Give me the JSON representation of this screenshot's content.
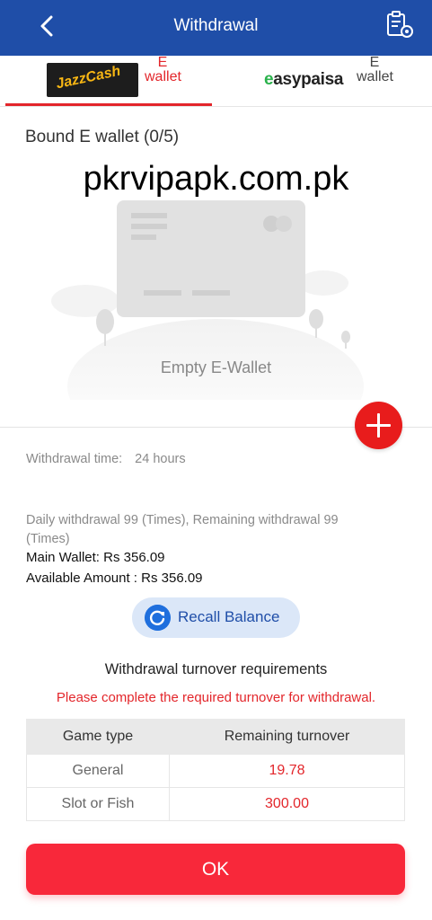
{
  "header": {
    "title": "Withdrawal",
    "back_icon": "chevron-left-icon",
    "settings_icon": "clipboard-gear-icon"
  },
  "tabs": [
    {
      "logo": "JazzCash",
      "label": "E wallet",
      "active": true
    },
    {
      "logo": "easypaisa",
      "label": "E wallet",
      "active": false
    }
  ],
  "bound_title": "Bound E wallet (0/5)",
  "watermark": "pkrvipapk.com.pk",
  "empty_label": "Empty E-Wallet",
  "add_icon": "plus-icon",
  "withdrawal_time": {
    "label": "Withdrawal time:",
    "value": "24 hours"
  },
  "daily_text": "Daily withdrawal 99 (Times), Remaining withdrawal 99 (Times)",
  "main_wallet": "Main Wallet: Rs 356.09",
  "available_amount": "Available Amount : Rs 356.09",
  "recall": {
    "label": "Recall Balance",
    "icon": "refresh-icon"
  },
  "requirements": {
    "title": "Withdrawal turnover requirements",
    "warning": "Please complete the required turnover for withdrawal.",
    "columns": [
      "Game type",
      "Remaining turnover"
    ],
    "rows": [
      {
        "type": "General",
        "remaining": "19.78"
      },
      {
        "type": "Slot or Fish",
        "remaining": "300.00"
      }
    ]
  },
  "ok_label": "OK",
  "colors": {
    "header": "#1f4ea8",
    "accent": "#e3262b",
    "button": "#f8283a"
  }
}
